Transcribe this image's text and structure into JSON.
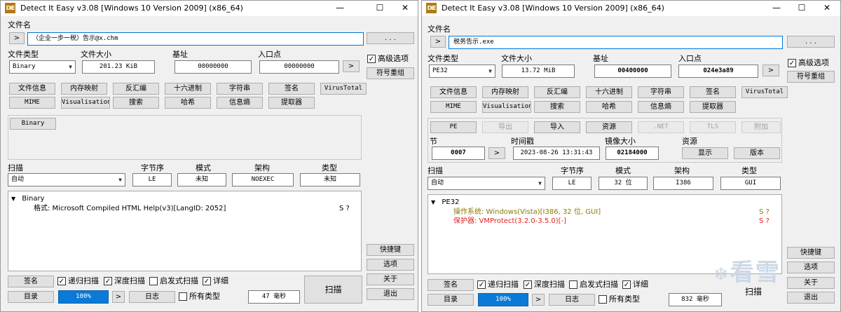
{
  "left": {
    "title": "Detect It Easy v3.08 [Windows 10 Version 2009] (x86_64)",
    "logo": "DiE",
    "win_controls": {
      "min": "—",
      "max": "☐",
      "close": "✕"
    },
    "file_label": "文件名",
    "arrow": ">",
    "file_path": "（企业一步一税）告示@x.chm",
    "browse": ". . .",
    "type_label": "文件类型",
    "size_label": "文件大小",
    "base_label": "基址",
    "entry_label": "入口点",
    "type_value": "Binary",
    "size_value": "201.23 KiB",
    "base_value": "00000000",
    "entry_value": "00000000",
    "advanced": "高级选项",
    "advanced_checked": "✓",
    "reorg": "符号重组",
    "tools_row1": [
      "文件信息",
      "内存映射",
      "反汇编",
      "十六进制",
      "字符串",
      "签名",
      "VirusTotal"
    ],
    "tools_row2": [
      "MIME",
      "Visualisation",
      "搜索",
      "哈希",
      "信息熵",
      "提取器"
    ],
    "binary_btn": "Binary",
    "scan_label": "扫描",
    "endian_label": "字节序",
    "mode_label": "模式",
    "arch_label": "架构",
    "kind_label": "类型",
    "scan_value": "自动",
    "endian_value": "LE",
    "mode_value": "未知",
    "arch_value": "NOEXEC",
    "kind_value": "未知",
    "tree_root": "Binary",
    "tree_child": "格式: Microsoft Compiled HTML Help(v3)[LangID: 2052]",
    "tree_child_flags": "S    ?",
    "side_buttons": [
      "快捷键",
      "选项",
      "关于",
      "退出"
    ],
    "sig_btn": "签名",
    "dir_btn": "目录",
    "log_btn": "日志",
    "recursive": "递归扫描",
    "deep": "深度扫描",
    "heuristic": "启发式扫描",
    "verbose": "详细",
    "alltypes": "所有类型",
    "progress": "100%",
    "elapsed": "47 毫秒",
    "scan_btn": "扫描"
  },
  "right": {
    "title": "Detect It Easy v3.08 [Windows 10 Version 2009] (x86_64)",
    "logo": "DiE",
    "win_controls": {
      "min": "—",
      "max": "☐",
      "close": "✕"
    },
    "file_label": "文件名",
    "arrow": ">",
    "file_path": "税务告示.exe",
    "browse": ". . .",
    "type_label": "文件类型",
    "size_label": "文件大小",
    "base_label": "基址",
    "entry_label": "入口点",
    "type_value": "PE32",
    "size_value": "13.72 MiB",
    "base_value": "00400000",
    "entry_value": "024e3a89",
    "advanced": "高级选项",
    "advanced_checked": "✓",
    "reorg": "符号重组",
    "tools_row1": [
      "文件信息",
      "内存映射",
      "反汇编",
      "十六进制",
      "字符串",
      "签名",
      "VirusTotal"
    ],
    "tools_row2": [
      "MIME",
      "Visualisation",
      "搜索",
      "哈希",
      "信息熵",
      "提取器"
    ],
    "pe_row": [
      "PE",
      "导出",
      "导入",
      "资源",
      ".NET",
      "TLS",
      "附加"
    ],
    "section_label": "节",
    "timestamp_label": "时间戳",
    "imagesize_label": "镜像大小",
    "resources_label": "资源",
    "section_value": "0007",
    "timestamp_value": "2023-08-26 13:31:43",
    "imagesize_value": "02184000",
    "display_btn": "显示",
    "version_btn": "版本",
    "scan_label": "扫描",
    "endian_label": "字节序",
    "mode_label": "模式",
    "arch_label": "架构",
    "kind_label": "类型",
    "scan_value": "自动",
    "endian_value": "LE",
    "mode_value": "32 位",
    "arch_value": "I386",
    "kind_value": "GUI",
    "tree_root": "PE32",
    "tree_os": "操作系统: Windows(Vista)[I386, 32 位, GUI]",
    "tree_os_flags": "S    ?",
    "tree_protector": "保护器: VMProtect(3.2.0-3.5.0)[-]",
    "tree_protector_flags": "S    ?",
    "os_color": "#8a7a00",
    "protector_color": "#e02020",
    "side_buttons": [
      "快捷键",
      "选项",
      "关于",
      "退出"
    ],
    "sig_btn": "签名",
    "dir_btn": "目录",
    "log_btn": "日志",
    "recursive": "递归扫描",
    "deep": "深度扫描",
    "heuristic": "启发式扫描",
    "verbose": "详细",
    "alltypes": "所有类型",
    "progress": "100%",
    "elapsed": "832 毫秒",
    "scan_btn": "扫描",
    "watermark": "看雪"
  }
}
